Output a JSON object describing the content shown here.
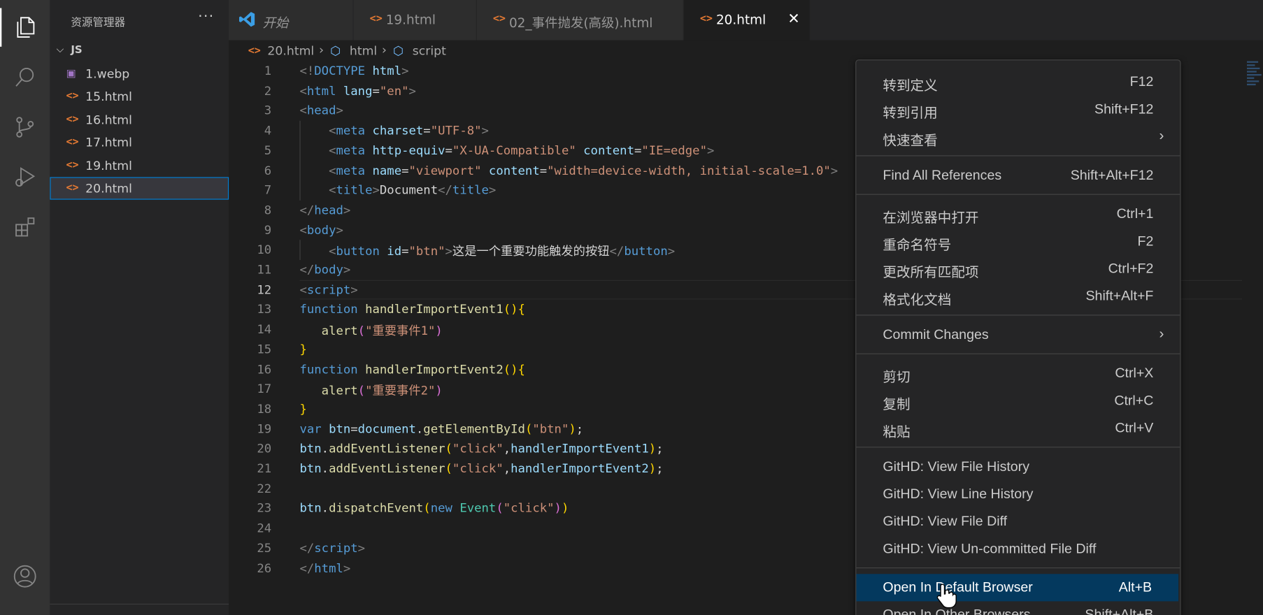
{
  "activity_bar": {
    "icons": [
      "files-icon",
      "search-icon",
      "source-control-icon",
      "run-debug-icon",
      "extensions-icon",
      "account-icon"
    ]
  },
  "sidebar": {
    "title": "资源管理器",
    "more": "···",
    "folder": "JS",
    "files": [
      {
        "name": "1.webp",
        "type": "image"
      },
      {
        "name": "15.html",
        "type": "html"
      },
      {
        "name": "16.html",
        "type": "html"
      },
      {
        "name": "17.html",
        "type": "html"
      },
      {
        "name": "19.html",
        "type": "html"
      },
      {
        "name": "20.html",
        "type": "html",
        "selected": true
      }
    ]
  },
  "tabs": [
    {
      "label": "开始",
      "kind": "start"
    },
    {
      "label": "19.html",
      "kind": "html"
    },
    {
      "label": "02_事件抛发(高级).html",
      "kind": "html"
    },
    {
      "label": "20.html",
      "kind": "html",
      "active": true
    }
  ],
  "breadcrumb": {
    "file": "20.html",
    "node1": "html",
    "node2": "script"
  },
  "editor": {
    "current_line": 12,
    "line_numbers": [
      "1",
      "2",
      "3",
      "4",
      "5",
      "6",
      "7",
      "8",
      "9",
      "10",
      "11",
      "12",
      "13",
      "14",
      "15",
      "16",
      "17",
      "18",
      "19",
      "20",
      "21",
      "22",
      "23",
      "24",
      "25",
      "26"
    ]
  },
  "context_menu": {
    "groups": [
      [
        {
          "label": "转到定义",
          "key": "F12"
        },
        {
          "label": "转到引用",
          "key": "Shift+F12"
        },
        {
          "label": "快速查看",
          "key": "",
          "submenu": true
        }
      ],
      [
        {
          "label": "Find All References",
          "key": "Shift+Alt+F12"
        }
      ],
      [
        {
          "label": "在浏览器中打开",
          "key": "Ctrl+1"
        },
        {
          "label": "重命名符号",
          "key": "F2"
        },
        {
          "label": "更改所有匹配项",
          "key": "Ctrl+F2"
        },
        {
          "label": "格式化文档",
          "key": "Shift+Alt+F"
        }
      ],
      [
        {
          "label": "Commit Changes",
          "key": "",
          "submenu": true
        }
      ],
      [
        {
          "label": "剪切",
          "key": "Ctrl+X"
        },
        {
          "label": "复制",
          "key": "Ctrl+C"
        },
        {
          "label": "粘贴",
          "key": "Ctrl+V"
        }
      ],
      [
        {
          "label": "GitHD: View File History",
          "key": ""
        },
        {
          "label": "GitHD: View Line History",
          "key": ""
        },
        {
          "label": "GitHD: View File Diff",
          "key": ""
        },
        {
          "label": "GitHD: View Un-committed File Diff",
          "key": ""
        }
      ],
      [
        {
          "label": "Open In Default Browser",
          "key": "Alt+B",
          "highlighted": true
        },
        {
          "label": "Open In Other Browsers",
          "key": "Shift+Alt+B"
        }
      ]
    ]
  },
  "colors": {
    "accent": "#007fd4",
    "menu_highlight": "#04395e",
    "html_icon": "#e37933"
  }
}
